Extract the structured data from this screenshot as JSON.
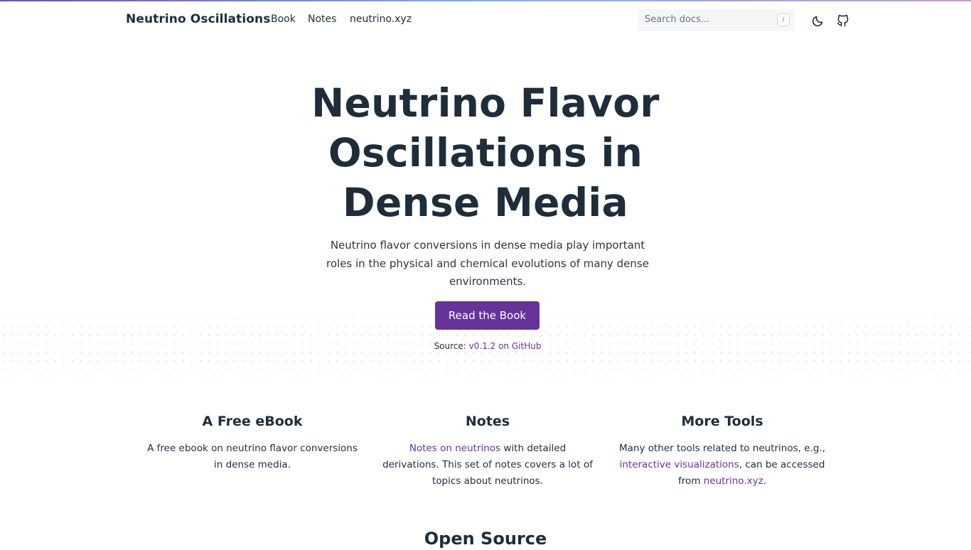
{
  "header": {
    "brand": "Neutrino Oscillations",
    "nav": [
      "Book",
      "Notes",
      "neutrino.xyz"
    ],
    "search": {
      "placeholder": "Search docs...",
      "shortcut": "/"
    },
    "icons": [
      "moon-icon",
      "github-icon"
    ]
  },
  "hero": {
    "title": "Neutrino Flavor Oscillations in Dense Media",
    "subtitle": "Neutrino flavor conversions in dense media play important roles in the physical and chemical evolutions of many dense environments.",
    "cta_label": "Read the Book",
    "source_prefix": "Source: ",
    "source_link": "v0.1.2 on GitHub"
  },
  "features": [
    {
      "title": "A Free eBook",
      "text": "A free ebook on neutrino flavor conversions in dense media."
    },
    {
      "title": "Notes",
      "link": "Notes on neutrinos",
      "text_after": " with detailed derivations. This set of notes covers a lot of topics about neutrinos."
    },
    {
      "title": "More Tools",
      "text_before": "Many other tools related to neutrinos, e.g., ",
      "link1": "interactive visualizations",
      "text_middle": ", can be accessed from ",
      "link2": "neutrino.xyz",
      "text_end": "."
    }
  ],
  "section_heading": "Open Source",
  "colors": {
    "accent": "#663399",
    "text": "#1f2d3a",
    "search_bg": "#f5f6f7"
  }
}
